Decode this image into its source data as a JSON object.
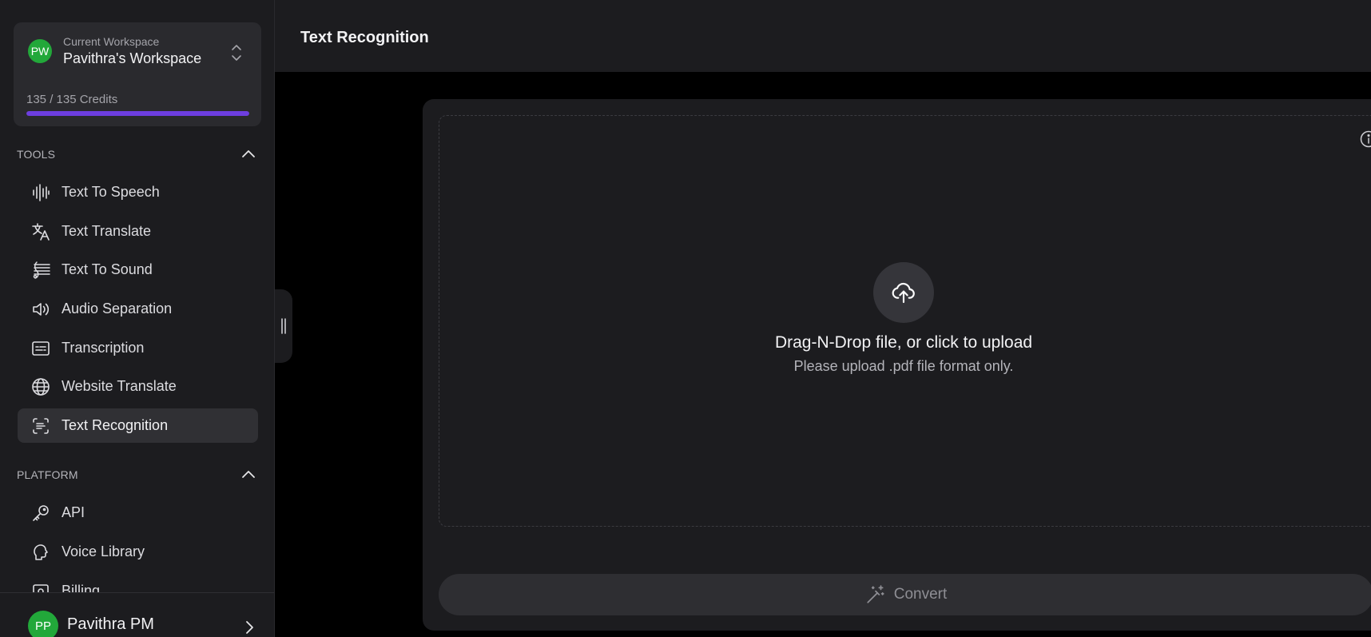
{
  "workspace": {
    "avatar_initials": "PW",
    "caption": "Current Workspace",
    "name": "Pavithra's Workspace",
    "credits_text": "135 / 135 Credits",
    "credits_fraction": 1.0
  },
  "tools": {
    "header": "TOOLS",
    "items": [
      {
        "label": "Text To Speech",
        "icon": "waveform-icon"
      },
      {
        "label": "Text Translate",
        "icon": "translate-icon"
      },
      {
        "label": "Text To Sound",
        "icon": "music-staff-icon"
      },
      {
        "label": "Audio Separation",
        "icon": "speaker-icon"
      },
      {
        "label": "Transcription",
        "icon": "subtitles-icon"
      },
      {
        "label": "Website Translate",
        "icon": "globe-icon"
      },
      {
        "label": "Text Recognition",
        "icon": "scan-text-icon",
        "active": true
      }
    ]
  },
  "platform": {
    "header": "PLATFORM",
    "items": [
      {
        "label": "API",
        "icon": "key-icon"
      },
      {
        "label": "Voice Library",
        "icon": "head-voice-icon"
      },
      {
        "label": "Billing",
        "icon": "billing-icon"
      }
    ]
  },
  "user": {
    "avatar_initials": "PP",
    "name": "Pavithra PM"
  },
  "header": {
    "title": "Text Recognition"
  },
  "dropzone": {
    "title": "Drag-N-Drop file, or click to upload",
    "subtitle": "Please upload .pdf file format only."
  },
  "convert_button": {
    "label": "Convert"
  },
  "colors": {
    "accent": "#6d3ee0",
    "avatar_green": "#22a83a",
    "sidebar_bg": "#1c1c1f",
    "page_bg": "#000000"
  }
}
